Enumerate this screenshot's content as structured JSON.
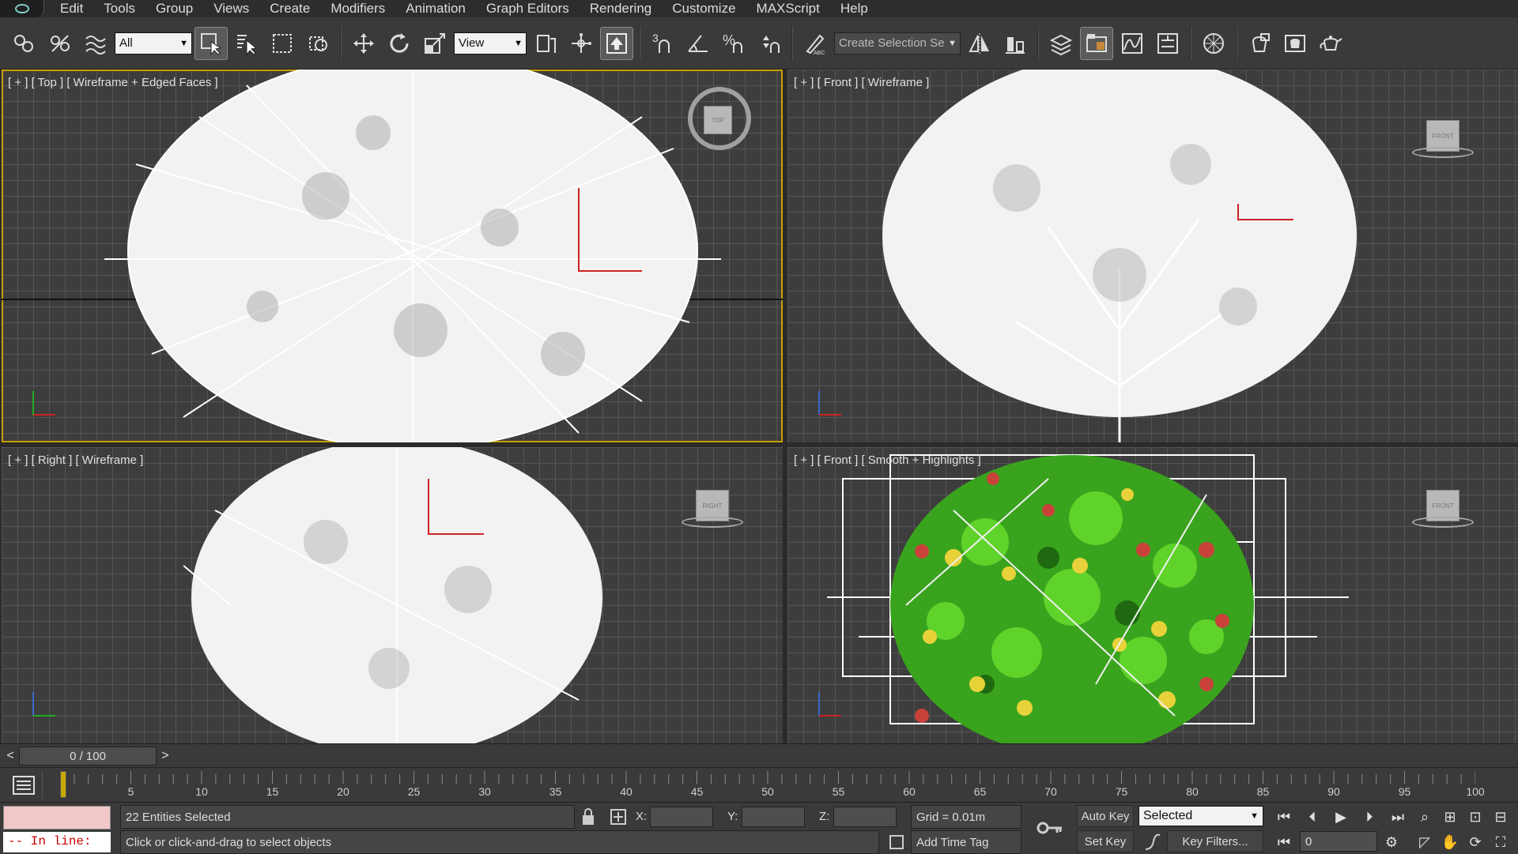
{
  "menu": [
    "Edit",
    "Tools",
    "Group",
    "Views",
    "Create",
    "Modifiers",
    "Animation",
    "Graph Editors",
    "Rendering",
    "Customize",
    "MAXScript",
    "Help"
  ],
  "toolbar": {
    "filter_value": "All",
    "coord_system": "View",
    "selection_set_placeholder": "Create Selection Se",
    "snap_3d": "3",
    "percent_snap": "%"
  },
  "viewports": {
    "top_left": {
      "label": "[ + ] [ Top ] [ Wireframe + Edged Faces ]",
      "cube": "TOP"
    },
    "top_right": {
      "label": "[ + ] [ Front ] [ Wireframe ]",
      "cube": "FRONT"
    },
    "bottom_left": {
      "label": "[ + ] [ Right ] [ Wireframe ]",
      "cube": "RIGHT"
    },
    "bottom_right": {
      "label": "[ + ] [ Front ] [ Smooth + Highlights ]",
      "cube": "FRONT"
    }
  },
  "timeline": {
    "frame_display": "0 / 100",
    "prev": "<",
    "next": ">",
    "ticks": [
      "5",
      "10",
      "15",
      "20",
      "25",
      "30",
      "35",
      "40",
      "45",
      "50",
      "55",
      "60",
      "65",
      "70",
      "75",
      "80",
      "85",
      "90",
      "95",
      "100"
    ]
  },
  "status": {
    "selection": "22 Entities Selected",
    "prompt": "Click or click-and-drag to select objects",
    "listener": "-- In line:",
    "x_label": "X:",
    "y_label": "Y:",
    "z_label": "Z:",
    "grid": "Grid = 0.01m",
    "add_time_tag": "Add Time Tag",
    "auto_key": "Auto Key",
    "set_key": "Set Key",
    "key_mode": "Selected",
    "key_filters": "Key Filters...",
    "current_frame": "0"
  },
  "colors": {
    "viewport_bg": "#3d3d3d",
    "active_border": "#c8a000",
    "foliage": "#3aa31e",
    "fruit_yellow": "#e8d23a",
    "fruit_red": "#c8423a"
  }
}
